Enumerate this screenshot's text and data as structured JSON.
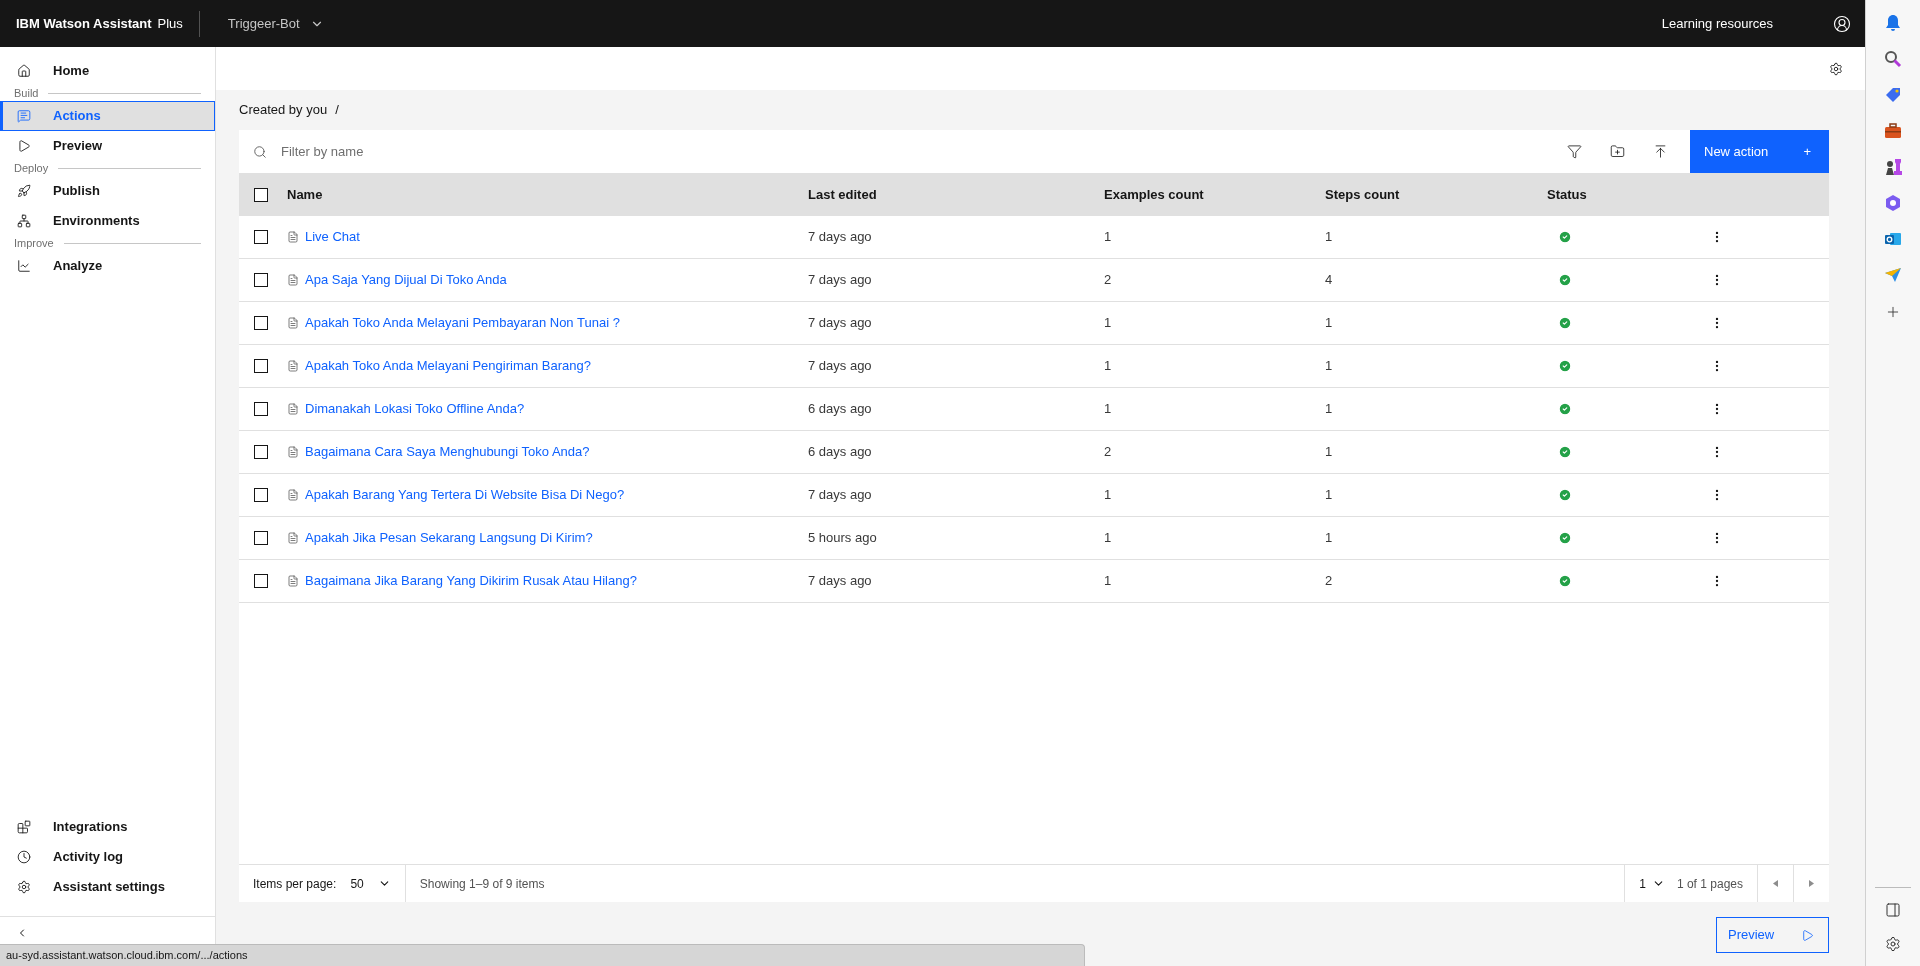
{
  "topbar": {
    "product": "IBM Watson Assistant",
    "plan": "Plus",
    "assistant": "Triggeer-Bot",
    "learning": "Learning resources"
  },
  "nav": [
    {
      "kind": "item",
      "label": "Home",
      "selected": false
    },
    {
      "kind": "section",
      "label": "Build"
    },
    {
      "kind": "item",
      "label": "Actions",
      "selected": true
    },
    {
      "kind": "item",
      "label": "Preview",
      "selected": false
    },
    {
      "kind": "section",
      "label": "Deploy"
    },
    {
      "kind": "item",
      "label": "Publish",
      "selected": false
    },
    {
      "kind": "item",
      "label": "Environments",
      "selected": false
    },
    {
      "kind": "section",
      "label": "Improve"
    },
    {
      "kind": "item",
      "label": "Analyze",
      "selected": false
    }
  ],
  "nav_bottom": [
    {
      "label": "Integrations",
      "selected": false
    },
    {
      "label": "Activity log",
      "selected": false
    },
    {
      "label": "Assistant settings",
      "selected": false
    }
  ],
  "breadcrumb": "Created by you",
  "breadcrumb_separator": "/",
  "search": {
    "placeholder": "Filter by name"
  },
  "new_action": "New action",
  "new_action_icon": "+",
  "table": {
    "select_all": {
      "checked": false
    },
    "columns": [
      "Name",
      "Last edited",
      "Examples count",
      "Steps count",
      "Status"
    ],
    "rows": [
      {
        "checked": false,
        "name": "Live Chat",
        "last_edited": "7 days ago",
        "examples": "1",
        "steps": "1",
        "valid": true
      },
      {
        "checked": false,
        "name": "Apa Saja Yang Dijual Di Toko Anda",
        "last_edited": "7 days ago",
        "examples": "2",
        "steps": "4",
        "valid": true
      },
      {
        "checked": false,
        "name": "Apakah Toko Anda Melayani Pembayaran Non Tunai ?",
        "last_edited": "7 days ago",
        "examples": "1",
        "steps": "1",
        "valid": true
      },
      {
        "checked": false,
        "name": "Apakah Toko Anda Melayani Pengiriman Barang?",
        "last_edited": "7 days ago",
        "examples": "1",
        "steps": "1",
        "valid": true
      },
      {
        "checked": false,
        "name": "Dimanakah Lokasi Toko Offline Anda?",
        "last_edited": "6 days ago",
        "examples": "1",
        "steps": "1",
        "valid": true
      },
      {
        "checked": false,
        "name": "Bagaimana Cara Saya Menghubungi Toko Anda?",
        "last_edited": "6 days ago",
        "examples": "2",
        "steps": "1",
        "valid": true
      },
      {
        "checked": false,
        "name": "Apakah Barang Yang Tertera Di Website Bisa Di Nego?",
        "last_edited": "7 days ago",
        "examples": "1",
        "steps": "1",
        "valid": true
      },
      {
        "checked": false,
        "name": "Apakah Jika Pesan Sekarang Langsung Di Kirim?",
        "last_edited": "5 hours ago",
        "examples": "1",
        "steps": "1",
        "valid": true
      },
      {
        "checked": false,
        "name": "Bagaimana Jika Barang Yang Dikirim Rusak Atau Hilang?",
        "last_edited": "7 days ago",
        "examples": "1",
        "steps": "2",
        "valid": true
      }
    ]
  },
  "pagination": {
    "items_per_page_label": "Items per page:",
    "items_per_page": "50",
    "showing": "Showing 1–9 of 9 items",
    "page": "1",
    "pages": "1 of 1 pages"
  },
  "preview_button": "Preview",
  "status_url": "au-syd.assistant.watson.cloud.ibm.com/.../actions"
}
